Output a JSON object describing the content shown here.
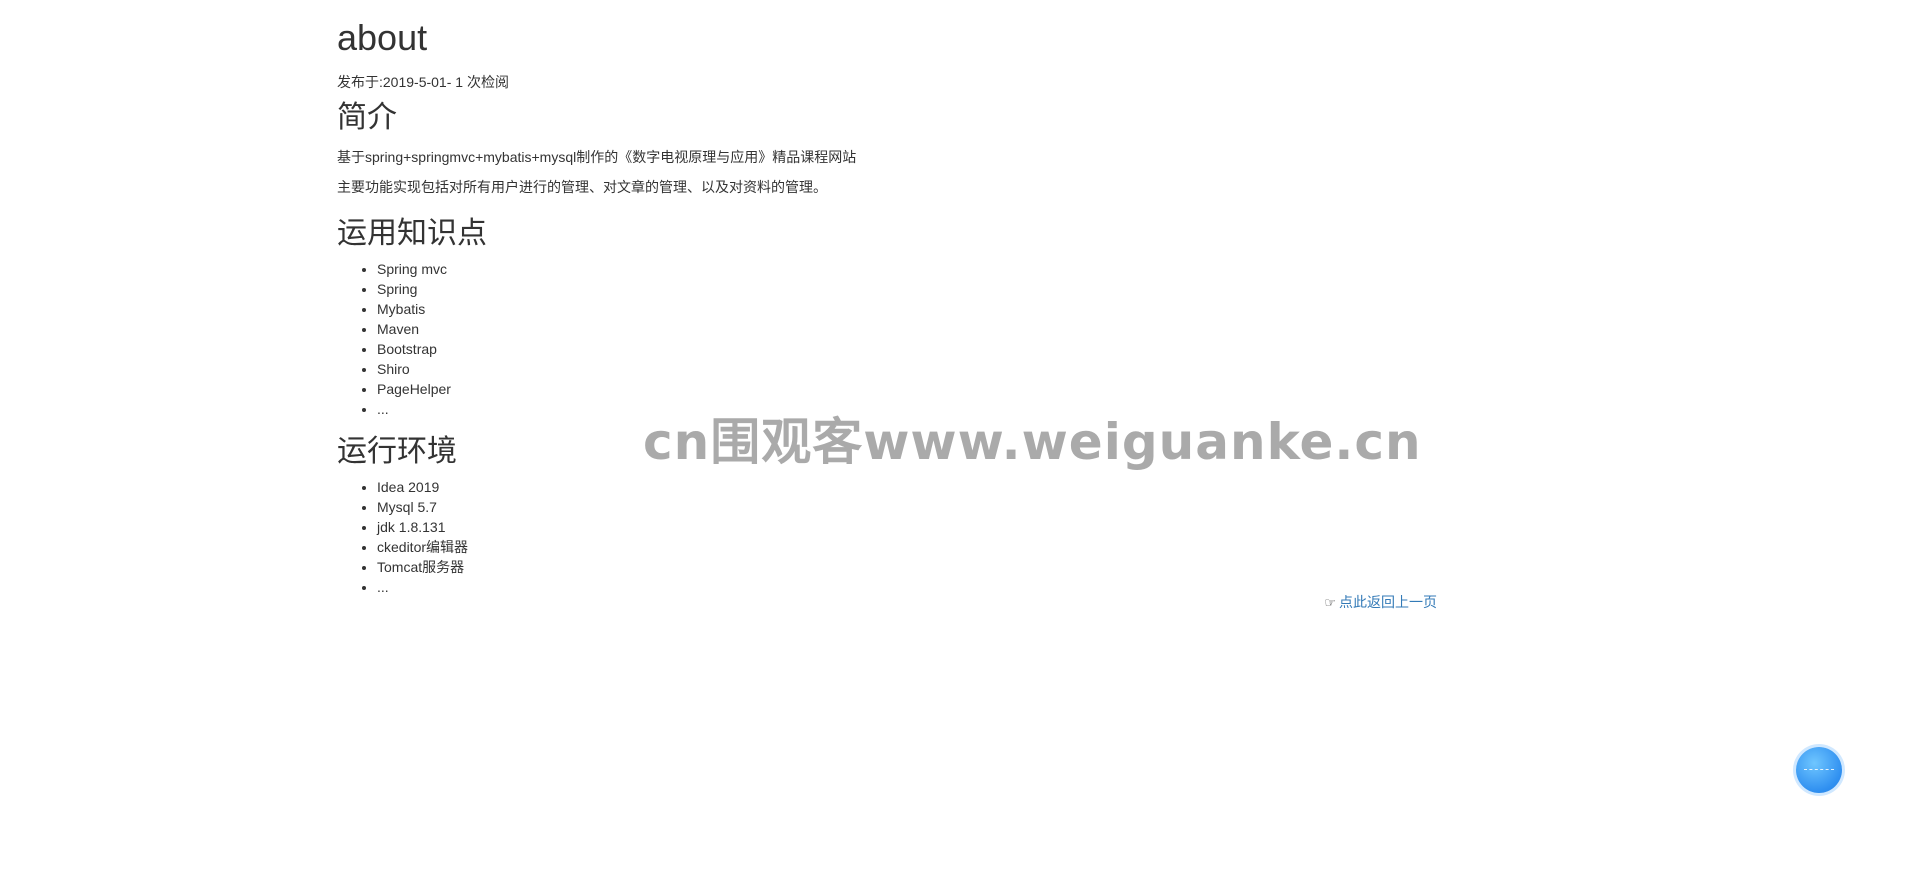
{
  "article": {
    "title": "about",
    "meta": "发布于:2019-5-01- 1 次检阅",
    "intro_heading": "简介",
    "intro_paragraphs": [
      "基于spring+springmvc+mybatis+mysql制作的《数字电视原理与应用》精品课程网站",
      "主要功能实现包括对所有用户进行的管理、对文章的管理、以及对资料的管理。"
    ],
    "knowledge_heading": "运用知识点",
    "knowledge_items": [
      "Spring mvc",
      "Spring",
      "Mybatis",
      "Maven",
      "Bootstrap",
      "Shiro",
      "PageHelper",
      "..."
    ],
    "env_heading": "运行环境",
    "env_items": [
      "Idea 2019",
      "Mysql 5.7",
      "jdk 1.8.131",
      "ckeditor编辑器",
      "Tomcat服务器",
      "..."
    ]
  },
  "back_link": {
    "label": "点此返回上一页",
    "icon": "hand-pointing-right-icon",
    "color": "#337ab7"
  },
  "watermark": {
    "text": "cn围观客www.weiguanke.cn"
  },
  "floating_button": {
    "icon": "float-action-icon",
    "color": "#2f8ff0"
  }
}
